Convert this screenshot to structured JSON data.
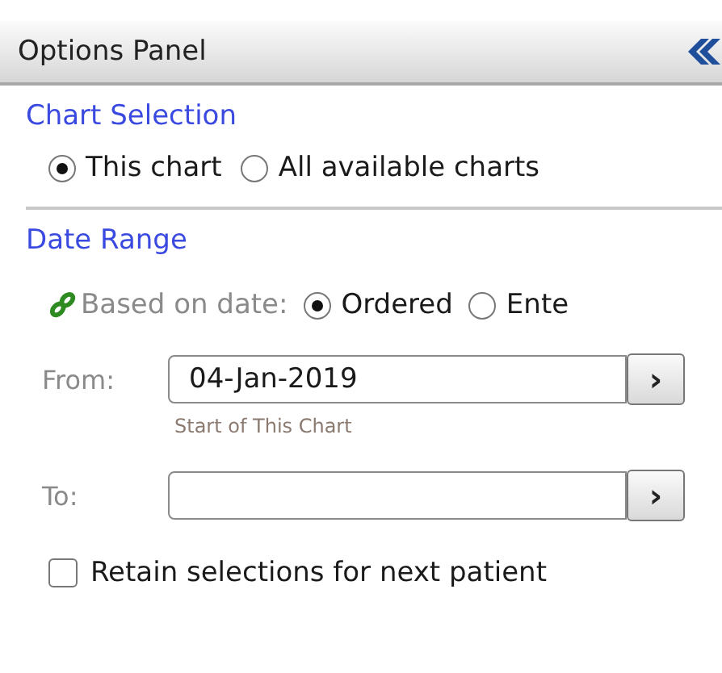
{
  "panel": {
    "title": "Options Panel"
  },
  "chart_selection": {
    "heading": "Chart Selection",
    "options": [
      {
        "label": "This chart",
        "selected": true
      },
      {
        "label": "All available charts",
        "selected": false
      }
    ]
  },
  "date_range": {
    "heading": "Date Range",
    "based_on_label": "Based on date:",
    "options": [
      {
        "label": "Ordered",
        "selected": true
      },
      {
        "label": "Ente",
        "selected": false
      }
    ],
    "fields": [
      {
        "label": "From:",
        "value": "04-Jan-2019",
        "button": "›",
        "hint": "Start of This Chart"
      },
      {
        "label": "To:",
        "button": "›"
      }
    ]
  },
  "retain": {
    "label": "Retain selections for next patient",
    "checked": false
  }
}
